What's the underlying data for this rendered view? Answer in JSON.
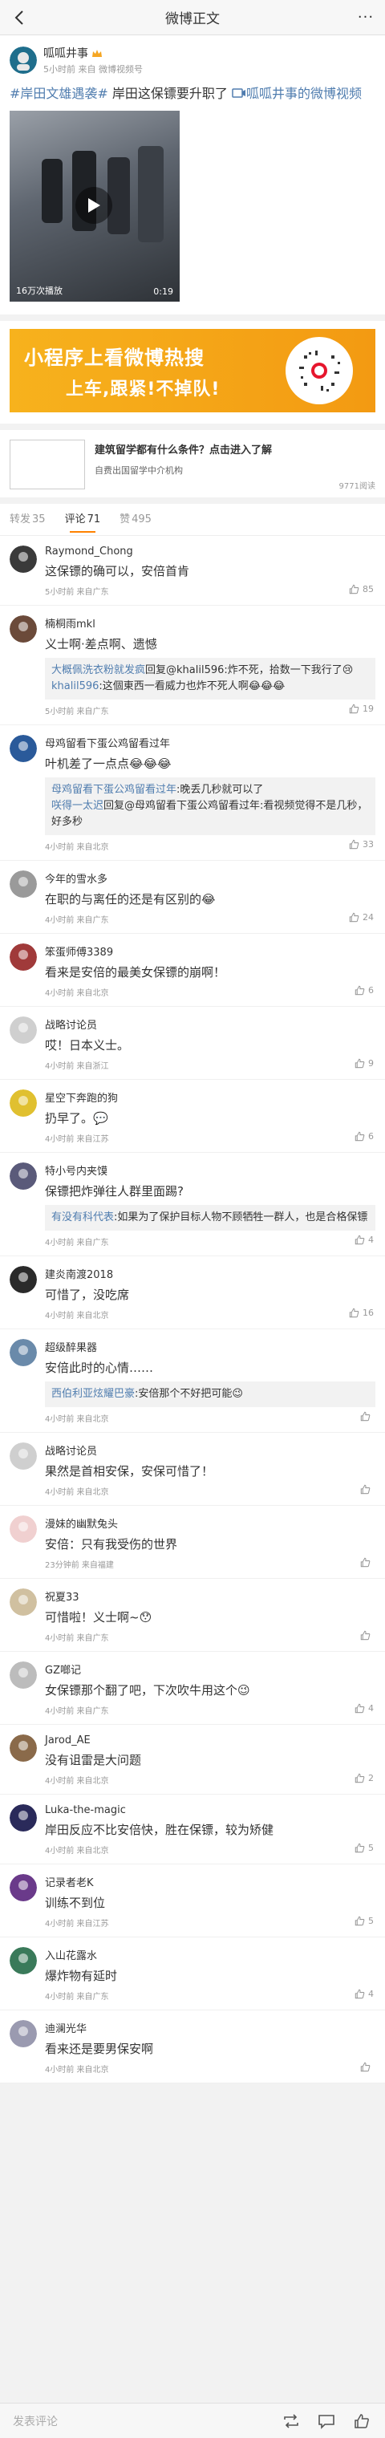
{
  "nav": {
    "title": "微博正文",
    "more": "···"
  },
  "post": {
    "author": "呱呱井事",
    "author_sub": "5小时前 来自 微博视频号",
    "tag": "#岸田文雄遇袭#",
    "text": " 岸田这保镖要升职了 ",
    "link": "呱呱井事的微博视频",
    "video_views": "16万次播放",
    "video_duration": "0:19"
  },
  "banner": {
    "line1": "小程序上看微博热搜",
    "line2": "上车,跟紧!不掉队!"
  },
  "ad": {
    "title": "建筑留学都有什么条件？点击进入了解",
    "subtitle": "自费出国留学中介机构",
    "reads": "9771阅读"
  },
  "tabs": [
    {
      "label": "转发",
      "count": "35"
    },
    {
      "label": "评论",
      "count": "71"
    },
    {
      "label": "赞",
      "count": "495"
    }
  ],
  "comments": [
    {
      "name": "Raymond_Chong",
      "text": "这保镖的确可以，安倍首肯",
      "meta": "5小时前 来自广东",
      "likes": "85",
      "avatar_color": "#3a3a3a"
    },
    {
      "name": "楠桐雨mkl",
      "text": "义士啊·差点啊、遗憾",
      "meta": "5小时前 来自广东",
      "likes": "19",
      "avatar_color": "#6b4a3a",
      "replies": [
        {
          "user": "大概佩洗衣粉就发疯",
          "text": "回复@khalil596:炸不死，拾数一下我行了😢"
        },
        {
          "user": "khalil596",
          "text": ":这個東西一看威力也炸不死人啊😂😂😂"
        }
      ]
    },
    {
      "name": "母鸡留看下蛋公鸡留看过年",
      "text": "叶机差了一点点😂😂😂",
      "meta": "4小时前 来自北京",
      "likes": "33",
      "avatar_color": "#2a5a9a",
      "replies": [
        {
          "user": "母鸡留看下蛋公鸡留看过年",
          "text": ":晚丢几秒就可以了"
        },
        {
          "user": "咲得一太迟",
          "text": "回复@母鸡留看下蛋公鸡留看过年:看视频觉得不是几秒，好多秒"
        }
      ]
    },
    {
      "name": "今年的雪水多",
      "text": "在职的与离任的还是有区别的😂",
      "meta": "4小时前 来自广东",
      "likes": "24",
      "avatar_color": "#9a9a9a"
    },
    {
      "name": "笨蛋师傅3389",
      "text": "看来是安倍的最美女保镖的崩啊！",
      "meta": "4小时前 来自北京",
      "likes": "6",
      "avatar_color": "#a03a3a"
    },
    {
      "name": "战略讨论员",
      "text": "哎！日本义士。",
      "meta": "4小时前 来自浙江",
      "likes": "9",
      "avatar_color": "#cfcfcf"
    },
    {
      "name": "星空下奔跑的狗",
      "text": "扔早了。💬",
      "meta": "4小时前 来自江苏",
      "likes": "6",
      "avatar_color": "#e0c030"
    },
    {
      "name": "特小号内夹馍",
      "text": "保镖把炸弹往人群里面踢?",
      "meta": "4小时前 来自广东",
      "likes": "4",
      "avatar_color": "#5a5a7a",
      "replies": [
        {
          "user": "有没有科代表",
          "text": ":如果为了保护目标人物不顾牺牲一群人，也是合格保镖"
        }
      ]
    },
    {
      "name": "建炎南渡2018",
      "text": "可惜了，没吃席",
      "meta": "4小时前 来自北京",
      "likes": "16",
      "avatar_color": "#2a2a2a"
    },
    {
      "name": "超级醉果器",
      "text": "安倍此时的心情……",
      "meta": "4小时前 来自北京",
      "likes": "",
      "avatar_color": "#6a8aaa",
      "replies": [
        {
          "user": "西伯利亚炫耀巴豪",
          "text": ":安倍那个不好把可能😉"
        }
      ]
    },
    {
      "name": "战略讨论员",
      "text": "果然是首相安保，安保可惜了！",
      "meta": "4小时前 来自北京",
      "likes": "",
      "avatar_color": "#cfcfcf"
    },
    {
      "name": "漫妹的幽默兔头",
      "text": "安倍：只有我受伤的世界",
      "meta": "23分钟前 来自福建",
      "likes": "",
      "avatar_color": "#f0d0d0"
    },
    {
      "name": "祝夏33",
      "text": "可惜啦！义士啊~😯",
      "meta": "4小时前 来自广东",
      "likes": "",
      "avatar_color": "#d0c0a0"
    },
    {
      "name": "GZ啷记",
      "text": "女保镖那个翻了吧，下次吹牛用这个😉",
      "meta": "4小时前 来自广东",
      "likes": "4",
      "avatar_color": "#bcbcbc"
    },
    {
      "name": "Jarod_AE",
      "text": "没有诅雷是大问题",
      "meta": "4小时前 来自北京",
      "likes": "2",
      "avatar_color": "#8a6a4a"
    },
    {
      "name": "Luka-the-magic",
      "text": "岸田反应不比安倍快，胜在保镖，较为矫健",
      "meta": "4小时前 来自北京",
      "likes": "5",
      "avatar_color": "#2a2a5a"
    },
    {
      "name": "记录者老K",
      "text": "训练不到位",
      "meta": "4小时前 来自江苏",
      "likes": "5",
      "avatar_color": "#6a3a8a"
    },
    {
      "name": "入山花露水",
      "text": "爆炸物有延时",
      "meta": "4小时前 来自广东",
      "likes": "4",
      "avatar_color": "#3a7a5a"
    },
    {
      "name": "迪澜光华",
      "text": "看来还是要男保安啊",
      "meta": "4小时前 来自北京",
      "likes": "",
      "avatar_color": "#9a9ab0"
    }
  ],
  "bottom": {
    "placeholder": "发表评论"
  }
}
